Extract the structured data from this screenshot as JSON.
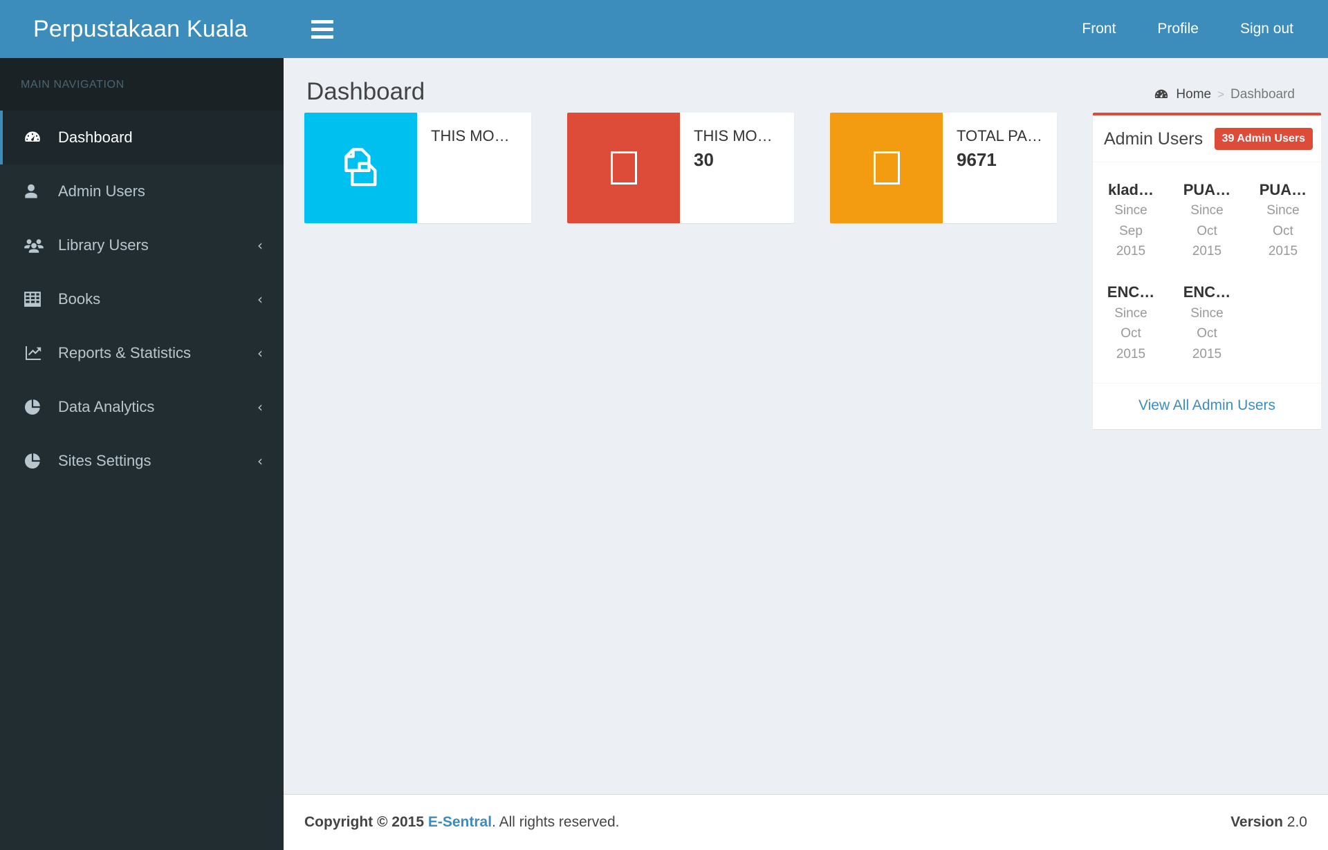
{
  "brand": {
    "name": "Perpustakaan Kuala"
  },
  "sidebar": {
    "header": "MAIN NAVIGATION",
    "items": [
      {
        "label": "Dashboard",
        "icon": "dashboard-icon",
        "active": true,
        "caret": ""
      },
      {
        "label": "Admin Users",
        "icon": "user-icon",
        "active": false,
        "caret": ""
      },
      {
        "label": "Library Users",
        "icon": "users-icon",
        "active": false,
        "caret": "‹"
      },
      {
        "label": "Books",
        "icon": "table-icon",
        "active": false,
        "caret": "‹"
      },
      {
        "label": "Reports & Statistics",
        "icon": "line-chart-icon",
        "active": false,
        "caret": "‹"
      },
      {
        "label": "Data Analytics",
        "icon": "pie-chart-icon",
        "active": false,
        "caret": "‹"
      },
      {
        "label": "Sites Settings",
        "icon": "pie-chart-icon",
        "active": false,
        "caret": "‹"
      }
    ]
  },
  "navbar": {
    "menu_toggle": "hamburger-icon",
    "links": [
      {
        "label": "Front"
      },
      {
        "label": "Profile"
      },
      {
        "label": "Sign out"
      }
    ]
  },
  "header": {
    "title": "Dashboard",
    "breadcrumb": {
      "home_icon": "dashboard-icon",
      "home": "Home",
      "separator": ">",
      "current": "Dashboard"
    }
  },
  "stat_boxes": [
    {
      "title": "THIS MON…",
      "value": "",
      "color": "#00c0ef",
      "icon": "copy-files-icon"
    },
    {
      "title": "THIS MON…",
      "value": "30",
      "color": "#dd4b39",
      "icon": "missing-glyph-icon"
    },
    {
      "title": "TOTAL PA…",
      "value": "9671",
      "color": "#f39c12",
      "icon": "missing-glyph-icon"
    }
  ],
  "admin_users_panel": {
    "title": "Admin Users",
    "badge": "39 Admin Users",
    "accent_color": "#dd4b39",
    "users": [
      {
        "name": "klad…",
        "since_label": "Since",
        "since_month": "Sep",
        "since_year": "2015"
      },
      {
        "name": "PUA…",
        "since_label": "Since",
        "since_month": "Oct",
        "since_year": "2015"
      },
      {
        "name": "PUA…",
        "since_label": "Since",
        "since_month": "Oct",
        "since_year": "2015"
      },
      {
        "name": "ENC…",
        "since_label": "Since",
        "since_month": "Oct",
        "since_year": "2015"
      },
      {
        "name": "ENC…",
        "since_label": "Since",
        "since_month": "Oct",
        "since_year": "2015"
      }
    ],
    "footer_link": "View All Admin Users"
  },
  "footer": {
    "copyright_strong": "Copyright © 2015",
    "brand_link": "E-Sentral",
    "copyright_rest": ". All rights reserved.",
    "version_label": "Version",
    "version_number": "2.0"
  }
}
